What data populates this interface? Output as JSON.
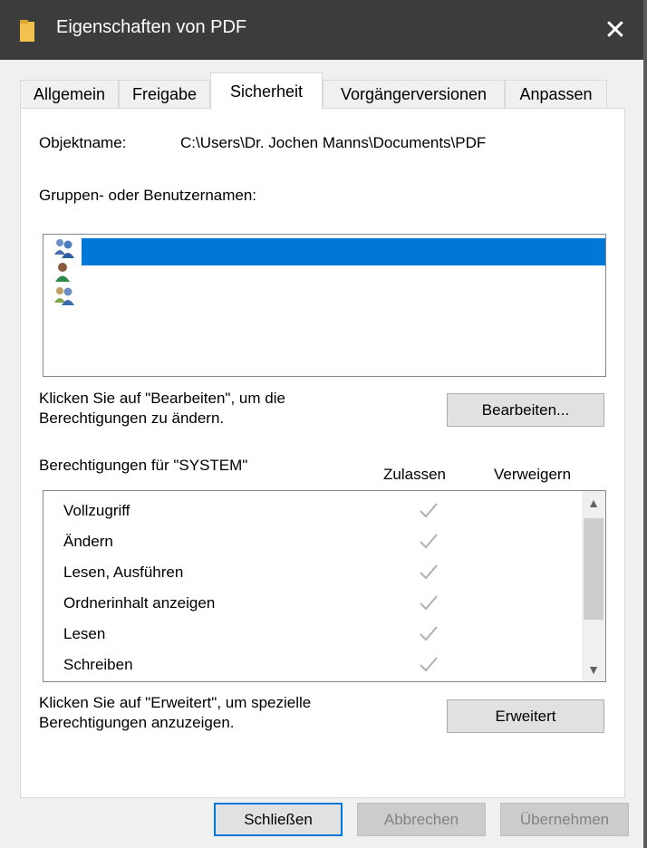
{
  "window": {
    "title": "Eigenschaften von PDF",
    "close_glyph": "✕"
  },
  "tabs": [
    {
      "label": "Allgemein"
    },
    {
      "label": "Freigabe"
    },
    {
      "label": "Sicherheit"
    },
    {
      "label": "Vorgängerversionen"
    },
    {
      "label": "Anpassen"
    }
  ],
  "active_tab": "Sicherheit",
  "security": {
    "object_name_label": "Objektname:",
    "object_name_value": "C:\\Users\\Dr. Jochen Manns\\Documents\\PDF",
    "groups_label": "Gruppen- oder Benutzernamen:",
    "users": [
      {
        "icon": "group-users-icon",
        "selected": true
      },
      {
        "icon": "single-user-icon",
        "selected": false
      },
      {
        "icon": "group-users-icon",
        "selected": false
      }
    ],
    "edit_hint_line1": "Klicken Sie auf \"Bearbeiten\", um die",
    "edit_hint_line2": "Berechtigungen zu ändern.",
    "edit_button": "Bearbeiten...",
    "permissions_for_label": "Berechtigungen für \"SYSTEM\"",
    "column_allow": "Zulassen",
    "column_deny": "Verweigern",
    "permissions": [
      {
        "name": "Vollzugriff",
        "allow": true
      },
      {
        "name": "Ändern",
        "allow": true
      },
      {
        "name": "Lesen, Ausführen",
        "allow": true
      },
      {
        "name": "Ordnerinhalt anzeigen",
        "allow": true
      },
      {
        "name": "Lesen",
        "allow": true
      },
      {
        "name": "Schreiben",
        "allow": true
      }
    ],
    "advanced_hint_line1": "Klicken Sie auf \"Erweitert\", um spezielle",
    "advanced_hint_line2": "Berechtigungen anzuzeigen.",
    "advanced_button": "Erweitert"
  },
  "footer": {
    "close_button": "Schließen",
    "cancel_button": "Abbrechen",
    "apply_button": "Übernehmen"
  },
  "colors": {
    "titlebar": "#3c3c3c",
    "selection": "#0078d7",
    "folder": "#f2c14e"
  }
}
